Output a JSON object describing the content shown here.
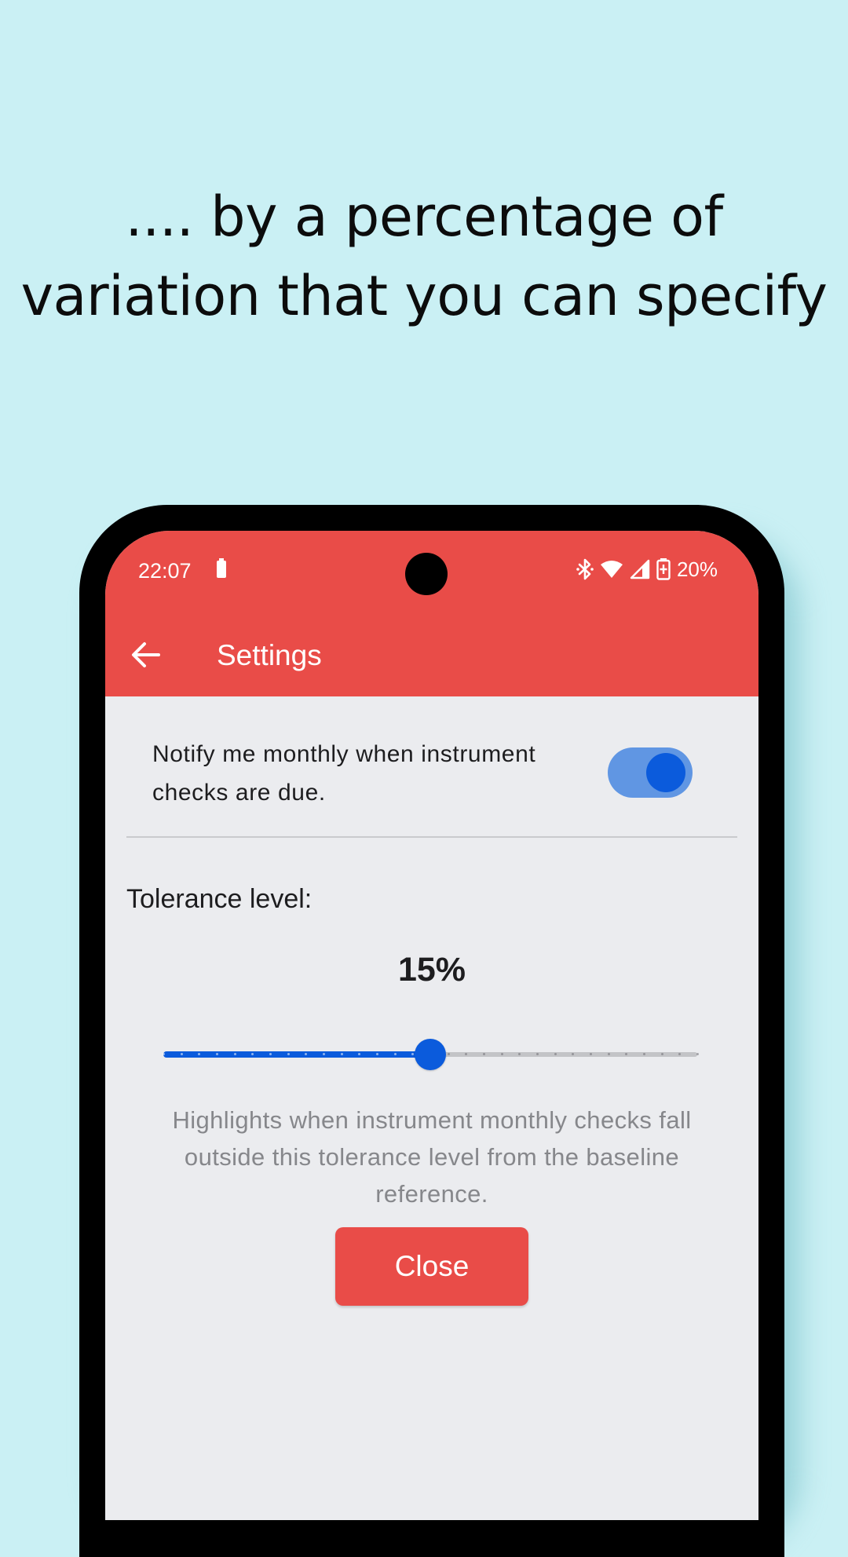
{
  "promo": {
    "title": ".... by a percentage of variation that you can specify"
  },
  "colors": {
    "background": "#caf0f4",
    "header": "#e94c48",
    "accent": "#0b5bdc",
    "toggle_track": "#6096e3",
    "screen": "#ebecef"
  },
  "status_bar": {
    "time": "22:07",
    "battery_percent": "20%",
    "icons": [
      "battery-icon",
      "bluetooth-icon",
      "wifi-icon",
      "signal-icon",
      "battery-charging-icon"
    ]
  },
  "app_bar": {
    "back_icon": "arrow-left-icon",
    "title": "Settings"
  },
  "settings": {
    "notify_label": "Notify me monthly when instrument checks are due.",
    "notify_enabled": true,
    "tolerance_label": "Tolerance level:",
    "tolerance_value": "15%",
    "slider": {
      "min": 0,
      "max": 30,
      "value": 15,
      "divisions": 30
    },
    "help_text": "Highlights when instrument monthly checks fall outside this tolerance level from the baseline reference.",
    "close_label": "Close"
  }
}
